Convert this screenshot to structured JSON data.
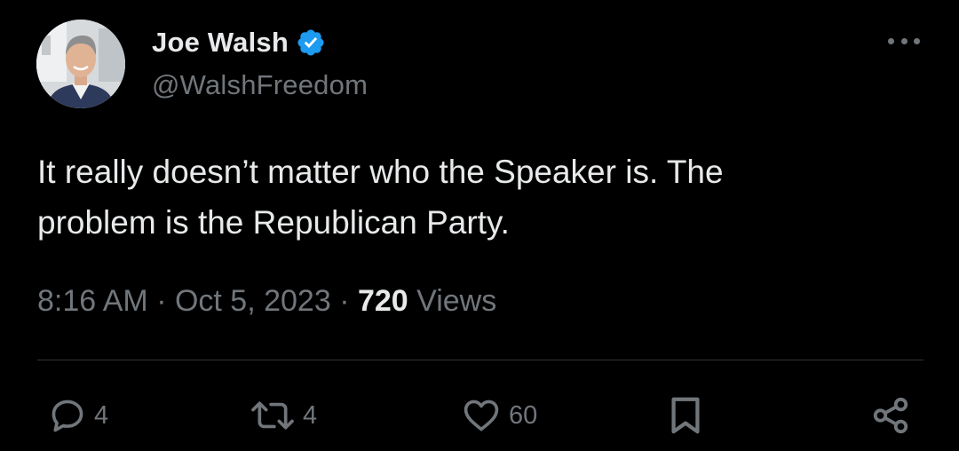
{
  "author": {
    "display_name": "Joe Walsh",
    "handle": "@WalshFreedom",
    "verified_color": "#1d9bf0",
    "avatar_icon": "profile-photo"
  },
  "tweet": {
    "text_line1": "It really doesn’t matter who the Speaker is. The",
    "text_line2": "problem is the Republican Party."
  },
  "meta": {
    "time": "8:16 AM",
    "separator1": " · ",
    "date": "Oct 5, 2023",
    "separator2": " · ",
    "views_count": "720",
    "views_label": " Views"
  },
  "actions": {
    "reply": {
      "icon": "reply-icon",
      "count": "4"
    },
    "retweet": {
      "icon": "retweet-icon",
      "count": "4"
    },
    "like": {
      "icon": "heart-icon",
      "count": "60"
    },
    "bookmark": {
      "icon": "bookmark-icon"
    },
    "share": {
      "icon": "share-icon"
    }
  },
  "colors": {
    "background": "#000000",
    "primary_text": "#e7e9ea",
    "secondary_text": "#71767b",
    "divider": "#2f3336",
    "verified": "#1d9bf0"
  }
}
